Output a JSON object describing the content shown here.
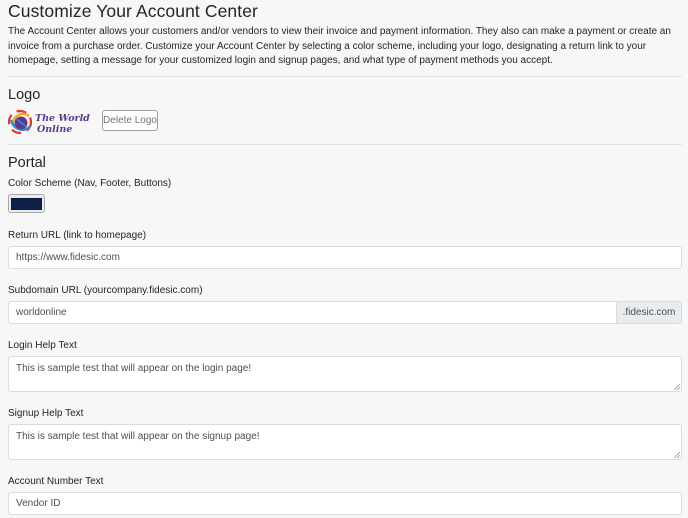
{
  "page": {
    "title": "Customize Your Account Center",
    "intro": "The Account Center allows your customers and/or vendors to view their invoice and payment information. They also can make a payment or create an invoice from a purchase order. Customize your Account Center by selecting a color scheme, including your logo, designating a return link to your homepage, setting a message for your customized login and signup pages, and what type of payment methods you accept."
  },
  "logo_section": {
    "heading": "Logo",
    "logo_text_line1": "The World",
    "logo_text_line2": "Online",
    "delete_label": "Delete Logo"
  },
  "portal": {
    "heading": "Portal",
    "color_scheme_label": "Color Scheme (Nav, Footer, Buttons)",
    "color_scheme_value": "#0d2148",
    "return_url_label": "Return URL (link to homepage)",
    "return_url_value": "https://www.fidesic.com",
    "subdomain_label": "Subdomain URL (yourcompany.fidesic.com)",
    "subdomain_value": "worldonline",
    "subdomain_suffix": ".fidesic.com",
    "login_help_label": "Login Help Text",
    "login_help_value": "This is sample test that will appear on the login page!",
    "signup_help_label": "Signup Help Text",
    "signup_help_value": "This is sample test that will appear on the signup page!",
    "account_number_label": "Account Number Text",
    "account_number_value": "Vendor ID"
  },
  "colors": {
    "background": "#f7f7f7",
    "logo_purple": "#5b3a8c",
    "swatch": "#0d2148"
  }
}
